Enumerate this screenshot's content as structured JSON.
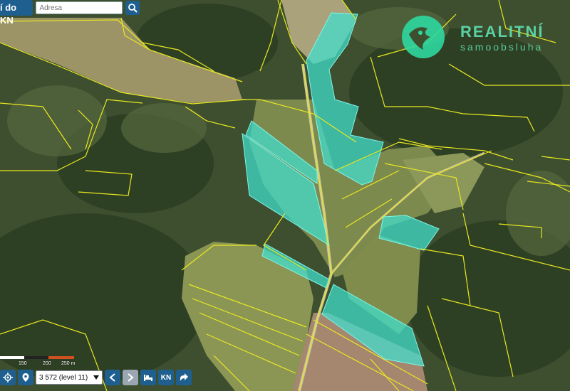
{
  "topbar": {
    "title": "í do KN",
    "address_placeholder": "Adresa",
    "search_icon": "search-icon"
  },
  "logo": {
    "name": "REALITNÍ",
    "tagline": "samoobsluha",
    "color": "#5fe0b0"
  },
  "scale": {
    "labels": [
      "150",
      "200",
      "250 m"
    ],
    "colors": [
      "#ffffff",
      "#d05020"
    ]
  },
  "toolbar": {
    "zoom_level": "3 572 (level 11)",
    "kn_label": "KN",
    "icons": [
      "gps-target-icon",
      "location-pin-icon",
      "chevron-left-icon",
      "chevron-right-icon",
      "bed-icon",
      "kn-icon",
      "share-icon"
    ]
  },
  "colors": {
    "parcel_line": "#e8e820",
    "highlight_fill": "#40e0d0",
    "button": "#1f5f8f"
  }
}
